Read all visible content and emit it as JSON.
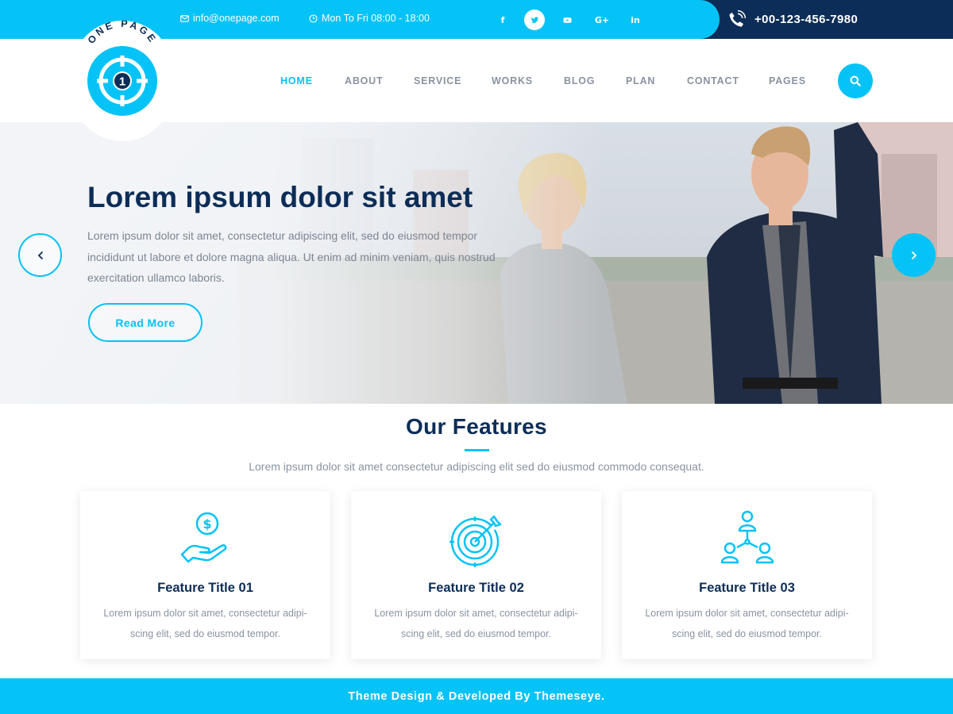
{
  "topbar": {
    "email": "info@onepage.com",
    "hours": "Mon To Fri 08:00 - 18:00",
    "social": [
      {
        "icon": "facebook-icon",
        "glyph": "f"
      },
      {
        "icon": "twitter-icon",
        "glyph": "t"
      },
      {
        "icon": "youtube-icon",
        "glyph": "▶"
      },
      {
        "icon": "google-plus-icon",
        "glyph": "G+"
      },
      {
        "icon": "linkedin-icon",
        "glyph": "in"
      }
    ],
    "phone": "+00-123-456-7980"
  },
  "logo": {
    "text": "ONE PAGE",
    "number": "1"
  },
  "nav": {
    "items": [
      "HOME",
      "ABOUT",
      "SERVICE",
      "WORKS",
      "BLOG",
      "PLAN",
      "CONTACT",
      "PAGES"
    ],
    "active": "HOME"
  },
  "hero": {
    "title": "Lorem ipsum dolor sit amet",
    "text": "Lorem ipsum dolor sit amet, consectetur adipiscing elit, sed do eiusmod tempor incididunt ut labore et dolore magna aliqua. Ut enim ad minim veniam, quis  nostrud exercitation ullamco laboris.",
    "button": "Read More"
  },
  "features": {
    "title": "Our Features",
    "subtitle": "Lorem ipsum dolor sit amet consectetur adipiscing elit sed do eiusmod commodo consequat.",
    "cards": [
      {
        "icon": "money-hand-icon",
        "title": "Feature Title 01",
        "text": "Lorem ipsum dolor sit amet, consectetur adipi-scing elit, sed do eiusmod tempor."
      },
      {
        "icon": "target-icon",
        "title": "Feature Title 02",
        "text": "Lorem ipsum dolor sit amet, consectetur adipi-scing elit, sed do eiusmod tempor."
      },
      {
        "icon": "team-network-icon",
        "title": "Feature Title 03",
        "text": "Lorem ipsum dolor sit amet, consectetur adipi-scing elit, sed do eiusmod tempor."
      }
    ]
  },
  "footer": {
    "text": "Theme Design & Developed By Themeseye."
  },
  "colors": {
    "accent": "#05c3f6",
    "navy": "#0c2d57",
    "muted": "#8a93a1"
  }
}
